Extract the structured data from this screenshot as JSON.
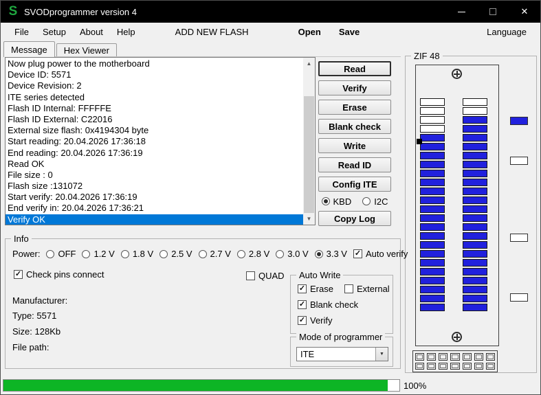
{
  "colors": {
    "titlebar_bg": "#000000",
    "selection_blue": "#0078d7",
    "pin_blue": "#2121dd",
    "progress_green": "#0db525",
    "logo_green": "#1fa63f"
  },
  "titlebar": {
    "logo_text": "S",
    "title": "SVODprogrammer version 4",
    "close_glyph": "✕"
  },
  "menubar": {
    "items": [
      "File",
      "Setup",
      "About",
      "Help"
    ],
    "add_new_flash": "ADD NEW FLASH",
    "open": "Open",
    "save": "Save",
    "language": "Language"
  },
  "tabs": {
    "message": "Message",
    "hex_viewer": "Hex Viewer",
    "active": "Message"
  },
  "icons": {
    "scroll_up": "▲",
    "scroll_down": "▼",
    "dropdown": "▼"
  },
  "log": {
    "lines": [
      "Now plug power to the motherboard",
      "Device ID: 5571",
      "Device Revision: 2",
      "ITE series detected",
      "Flash ID Internal: FFFFFE",
      "Flash ID External: C22016",
      "External size flash: 0x4194304 byte",
      "Start reading: 20.04.2026 17:36:18",
      "End reading: 20.04.2026 17:36:19",
      "Read OK",
      "File size : 0",
      "Flash size :131072",
      "Start verify: 20.04.2026 17:36:19",
      "End verify in: 20.04.2026 17:36:21",
      "Verify OK"
    ],
    "selected_line": "Verify OK",
    "selected_index": 14
  },
  "actions": {
    "read": "Read",
    "verify": "Verify",
    "erase": "Erase",
    "blank_check": "Blank check",
    "write": "Write",
    "read_id": "Read ID",
    "config_ite": "Config ITE",
    "kbd": "KBD",
    "i2c": "I2C",
    "interface_selected": "KBD",
    "copy_log": "Copy Log"
  },
  "zif": {
    "title": "ZIF 48",
    "left_pins": [
      0,
      0,
      0,
      0,
      1,
      1,
      1,
      1,
      1,
      1,
      1,
      1,
      1,
      1,
      1,
      1,
      1,
      1,
      1,
      1,
      1,
      1,
      1,
      1
    ],
    "right_pins": [
      0,
      0,
      1,
      1,
      1,
      1,
      1,
      1,
      1,
      1,
      1,
      1,
      1,
      1,
      1,
      1,
      1,
      1,
      1,
      1,
      1,
      1,
      1,
      1
    ],
    "side_slots": [
      1,
      0,
      0,
      0
    ],
    "grid_squares": 14
  },
  "info": {
    "title": "Info",
    "power_label": "Power:",
    "power_options": [
      "OFF",
      "1.2 V",
      "1.8 V",
      "2.5 V",
      "2.7 V",
      "2.8 V",
      "3.0 V",
      "3.3 V"
    ],
    "power_selected": "3.3 V",
    "auto_verify": "Auto verify",
    "auto_verify_checked": true,
    "check_pins_connect": "Check pins connect",
    "check_pins_checked": true,
    "quad": "QUAD",
    "quad_checked": false,
    "manufacturer_label": "Manufacturer:",
    "type_label": "Type: 5571",
    "size_label": "Size: 128Kb",
    "file_path_label": "File path:"
  },
  "auto_write": {
    "title": "Auto Write",
    "erase": "Erase",
    "erase_checked": true,
    "external": "External",
    "external_checked": false,
    "blank_check": "Blank check",
    "blank_check_checked": true,
    "verify": "Verify",
    "verify_checked": true
  },
  "mode": {
    "title": "Mode of programmer",
    "value": "ITE"
  },
  "progress": {
    "label": "100%",
    "fill_percent": 97
  }
}
